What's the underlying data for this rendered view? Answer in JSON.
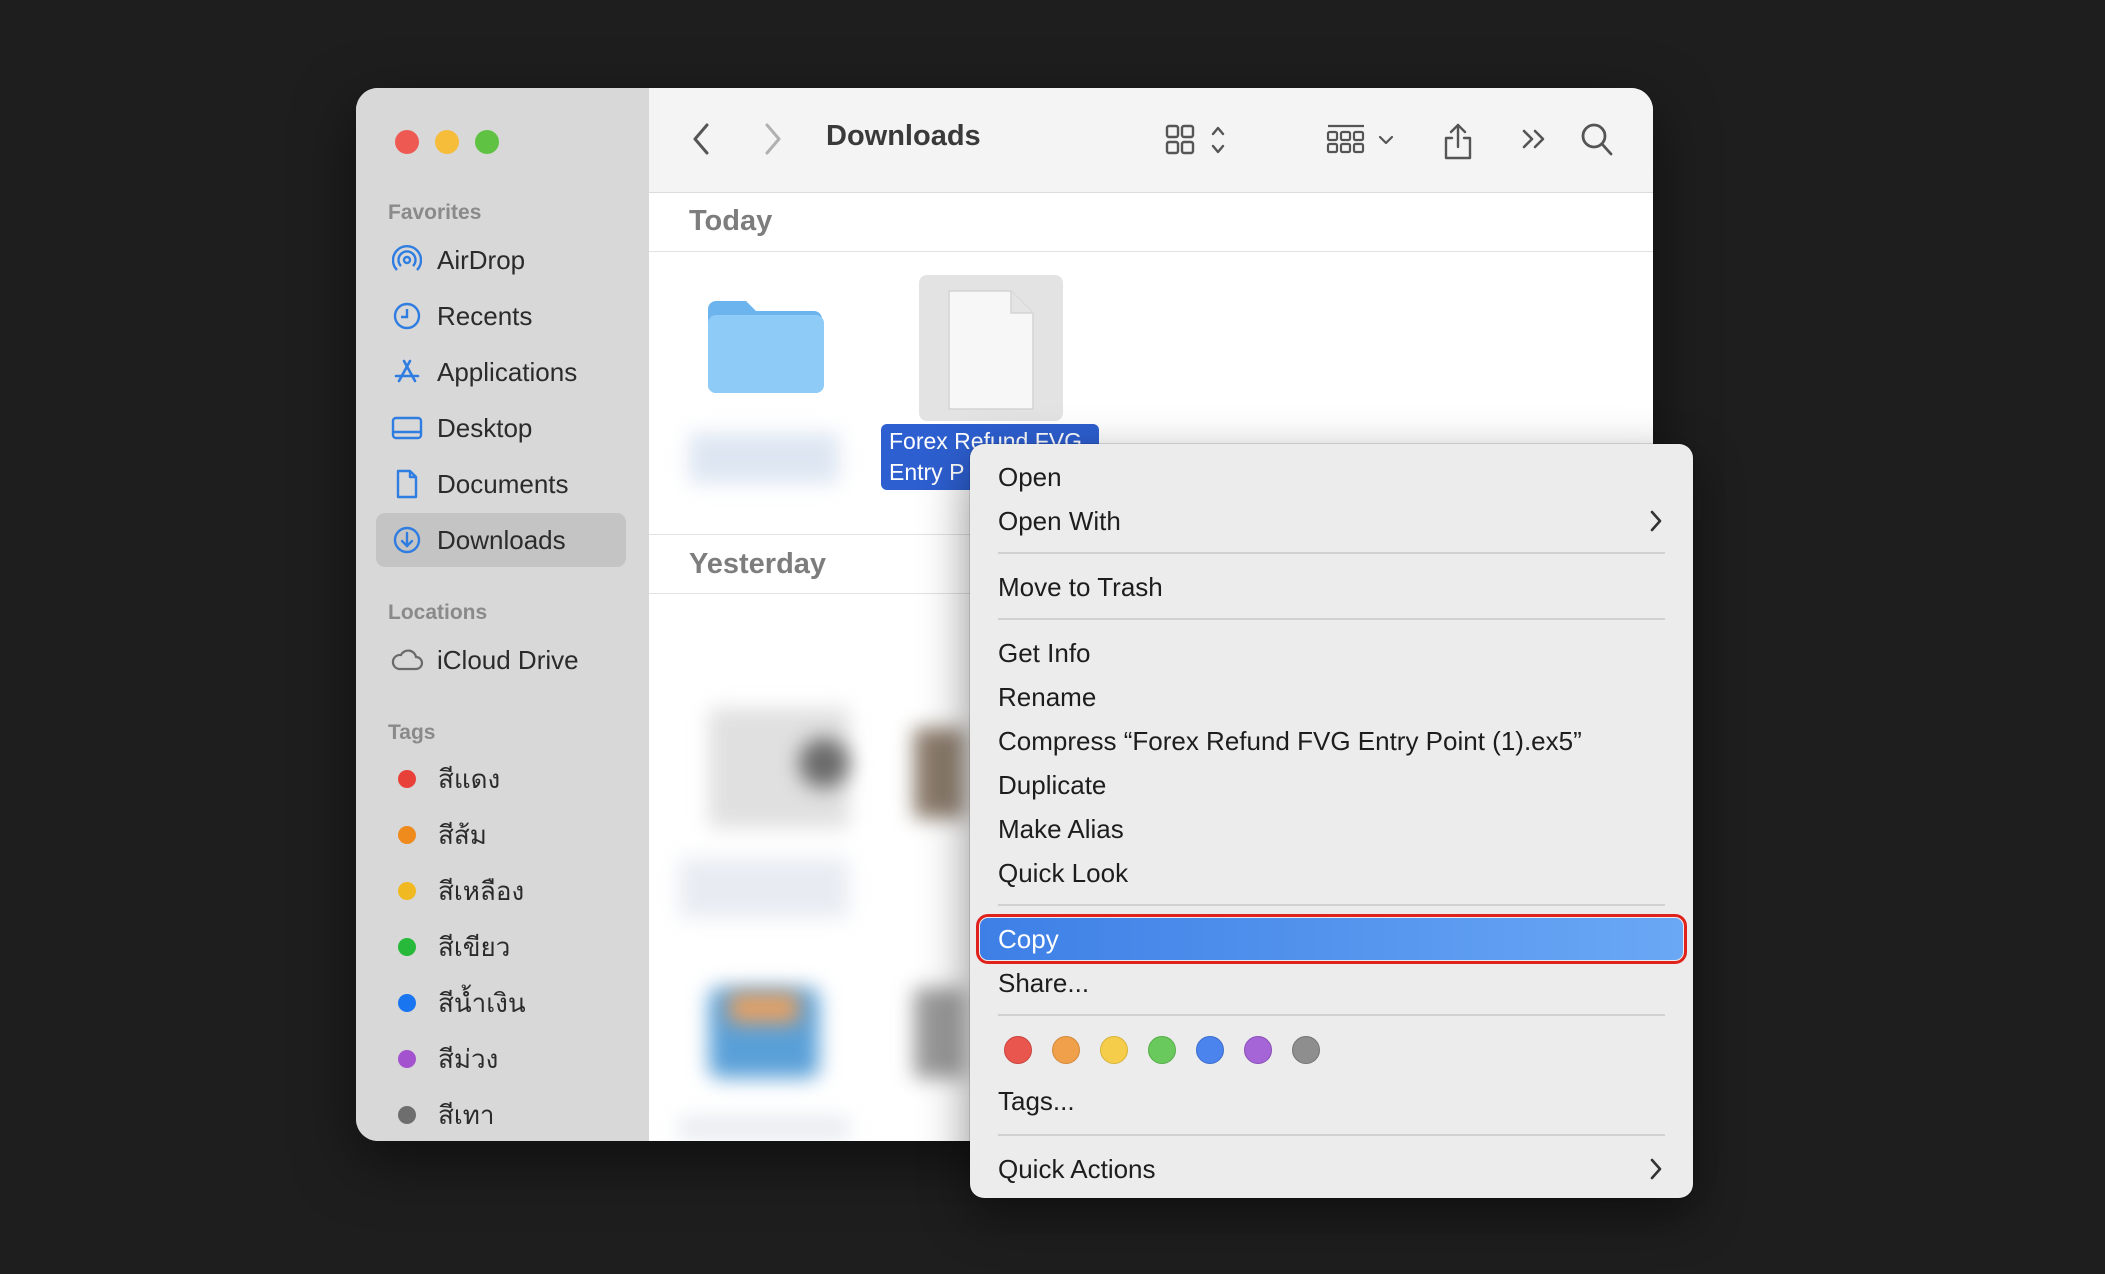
{
  "window": {
    "title": "Downloads"
  },
  "sidebar": {
    "favorites_label": "Favorites",
    "favorites": [
      {
        "label": "AirDrop",
        "icon": "airdrop-icon"
      },
      {
        "label": "Recents",
        "icon": "clock-icon"
      },
      {
        "label": "Applications",
        "icon": "applications-icon"
      },
      {
        "label": "Desktop",
        "icon": "desktop-icon"
      },
      {
        "label": "Documents",
        "icon": "document-icon"
      },
      {
        "label": "Downloads",
        "icon": "download-icon",
        "selected": true
      }
    ],
    "locations_label": "Locations",
    "locations": [
      {
        "label": "iCloud Drive",
        "icon": "cloud-icon"
      }
    ],
    "tags_label": "Tags",
    "tags": [
      {
        "label": "สีแดง",
        "color": "#e8413a"
      },
      {
        "label": "สีส้ม",
        "color": "#ef8a1c"
      },
      {
        "label": "สีเหลือง",
        "color": "#f0b922"
      },
      {
        "label": "สีเขียว",
        "color": "#27b93a"
      },
      {
        "label": "สีน้ำเงิน",
        "color": "#1976f0"
      },
      {
        "label": "สีม่วง",
        "color": "#a453cf"
      },
      {
        "label": "สีเทา",
        "color": "#6e6e6e"
      }
    ]
  },
  "content": {
    "group_today": "Today",
    "group_yesterday": "Yesterday",
    "selected_file_label": "Forex Refund FVG Entry P"
  },
  "context_menu": {
    "open": "Open",
    "open_with": "Open With",
    "move_to_trash": "Move to Trash",
    "get_info": "Get Info",
    "rename": "Rename",
    "compress": "Compress “Forex Refund FVG Entry Point (1).ex5”",
    "duplicate": "Duplicate",
    "make_alias": "Make Alias",
    "quick_look": "Quick Look",
    "copy": "Copy",
    "share": "Share...",
    "tag_colors": [
      "#e8564e",
      "#f0a04a",
      "#f5cd4a",
      "#6ac95c",
      "#4a84ec",
      "#a665d6",
      "#8e8e8e"
    ],
    "tags": "Tags...",
    "quick_actions": "Quick Actions"
  }
}
